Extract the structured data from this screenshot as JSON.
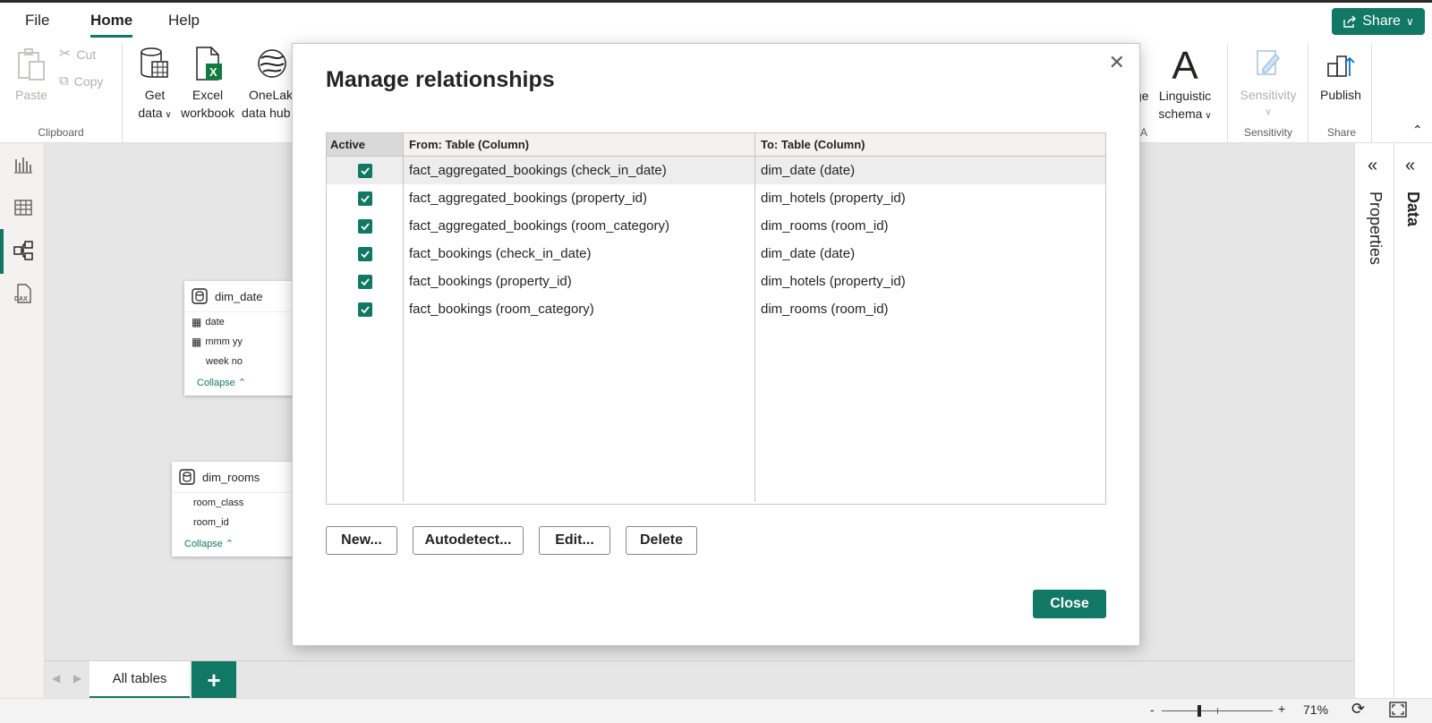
{
  "tabs": [
    {
      "label": "File"
    },
    {
      "label": "Home"
    },
    {
      "label": "Help"
    }
  ],
  "share": {
    "label": "Share"
  },
  "ribbon": {
    "clipboard": {
      "paste": "Paste",
      "cut": "Cut",
      "copy": "Copy",
      "group": "Clipboard"
    },
    "get_data": {
      "line1": "Get",
      "line2": "data"
    },
    "excel": {
      "line1": "Excel",
      "line2": "workbook"
    },
    "onelake": {
      "line1": "OneLak",
      "line2": "data hub"
    },
    "manage_partial": "ge",
    "linguistic": {
      "line1": "Linguistic",
      "line2": "schema"
    },
    "qa_partial": "A",
    "sensitivity": {
      "label": "Sensitivity",
      "group": "Sensitivity"
    },
    "publish": {
      "label": "Publish",
      "group": "Share"
    }
  },
  "canvas": {
    "dim_date": {
      "name": "dim_date",
      "fields": [
        "date",
        "mmm yy",
        "week no"
      ],
      "collapse": "Collapse"
    },
    "dim_rooms": {
      "name": "dim_rooms",
      "fields": [
        "room_class",
        "room_id"
      ],
      "collapse": "Collapse"
    }
  },
  "panes": {
    "properties": "Properties",
    "data": "Data"
  },
  "page_tabs": {
    "all_tables": "All tables",
    "add": "+"
  },
  "status": {
    "minus": "-",
    "plus": "+",
    "zoom": "71%"
  },
  "dialog": {
    "title": "Manage relationships",
    "columns": {
      "active": "Active",
      "from": "From: Table (Column)",
      "to": "To: Table (Column)"
    },
    "rows": [
      {
        "active": true,
        "from": "fact_aggregated_bookings (check_in_date)",
        "to": "dim_date (date)"
      },
      {
        "active": true,
        "from": "fact_aggregated_bookings (property_id)",
        "to": "dim_hotels (property_id)"
      },
      {
        "active": true,
        "from": "fact_aggregated_bookings (room_category)",
        "to": "dim_rooms (room_id)"
      },
      {
        "active": true,
        "from": "fact_bookings (check_in_date)",
        "to": "dim_date (date)"
      },
      {
        "active": true,
        "from": "fact_bookings (property_id)",
        "to": "dim_hotels (property_id)"
      },
      {
        "active": true,
        "from": "fact_bookings (room_category)",
        "to": "dim_rooms (room_id)"
      }
    ],
    "buttons": {
      "new": "New...",
      "autodetect": "Autodetect...",
      "edit": "Edit...",
      "delete": "Delete",
      "close": "Close"
    }
  },
  "colors": {
    "accent": "#117865"
  }
}
